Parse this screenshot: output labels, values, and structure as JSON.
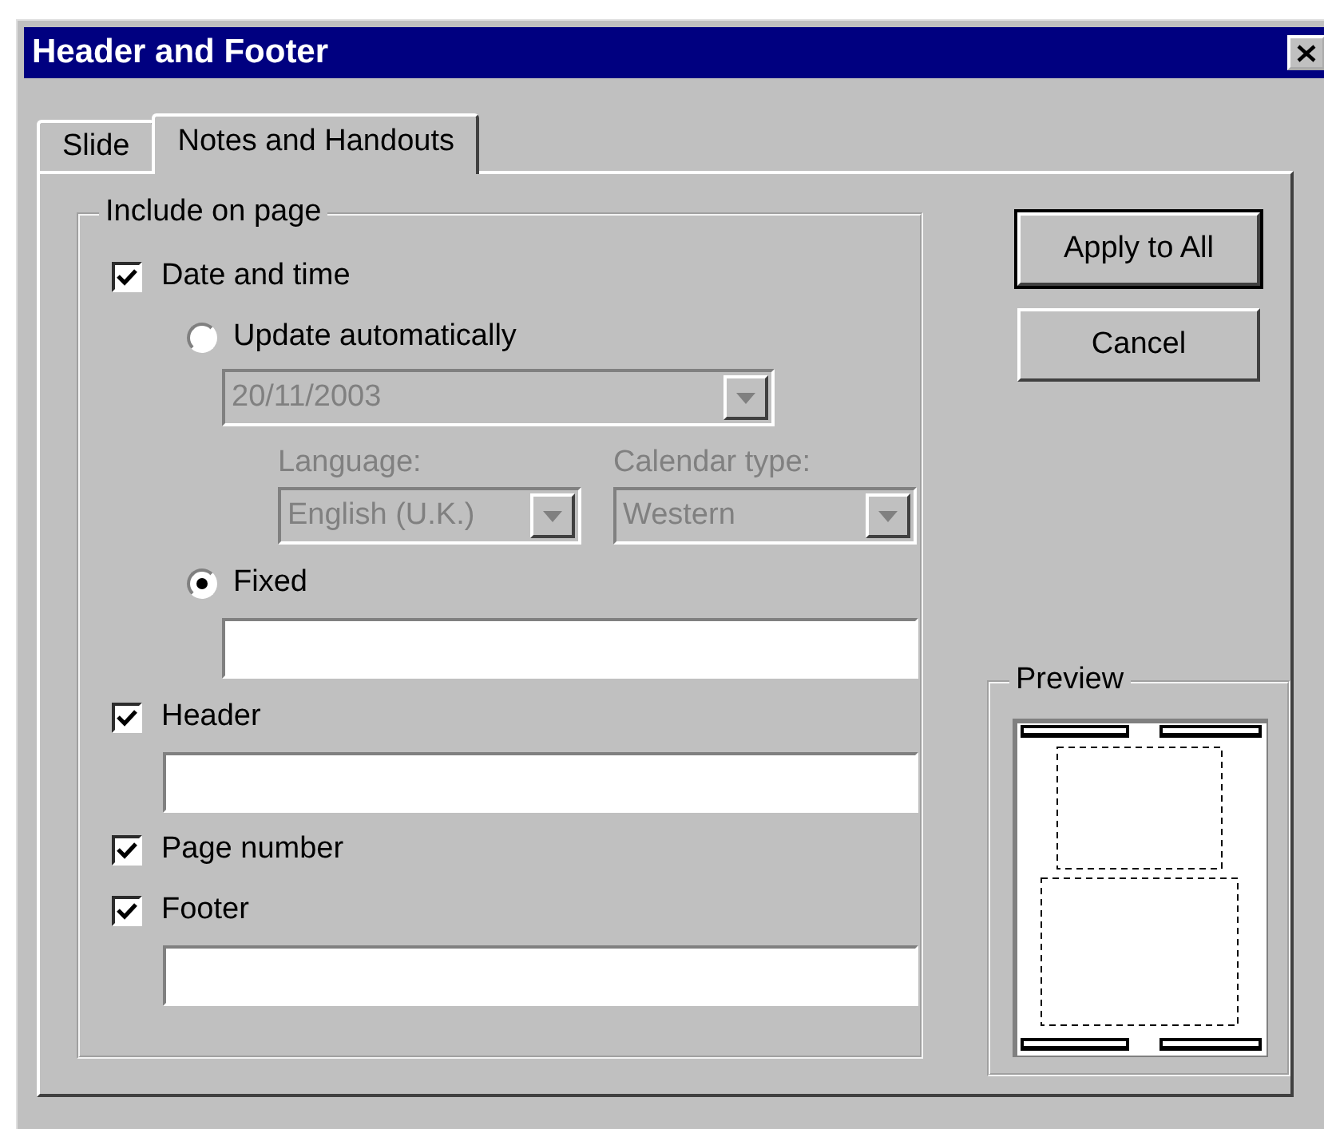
{
  "window": {
    "title": "Header and Footer"
  },
  "tabs": [
    {
      "label": "Slide",
      "selected": false
    },
    {
      "label": "Notes and Handouts",
      "selected": true
    }
  ],
  "include_on_page": {
    "title": "Include on page",
    "date_and_time": {
      "label": "Date and time",
      "checked": true
    },
    "update_automatically": {
      "label": "Update automatically",
      "selected": false
    },
    "date_format": {
      "value": "20/11/2003",
      "disabled": true
    },
    "language": {
      "label": "Language:",
      "value": "English (U.K.)",
      "disabled": true
    },
    "calendar_type": {
      "label": "Calendar type:",
      "value": "Western",
      "disabled": true
    },
    "fixed": {
      "label": "Fixed",
      "selected": true
    },
    "header": {
      "label": "Header",
      "checked": true
    },
    "page_number": {
      "label": "Page number",
      "checked": true
    },
    "footer": {
      "label": "Footer",
      "checked": true
    }
  },
  "buttons": [
    {
      "label": "Apply to All",
      "default": true
    },
    {
      "label": "Cancel",
      "default": false
    }
  ],
  "preview": {
    "title": "Preview"
  }
}
